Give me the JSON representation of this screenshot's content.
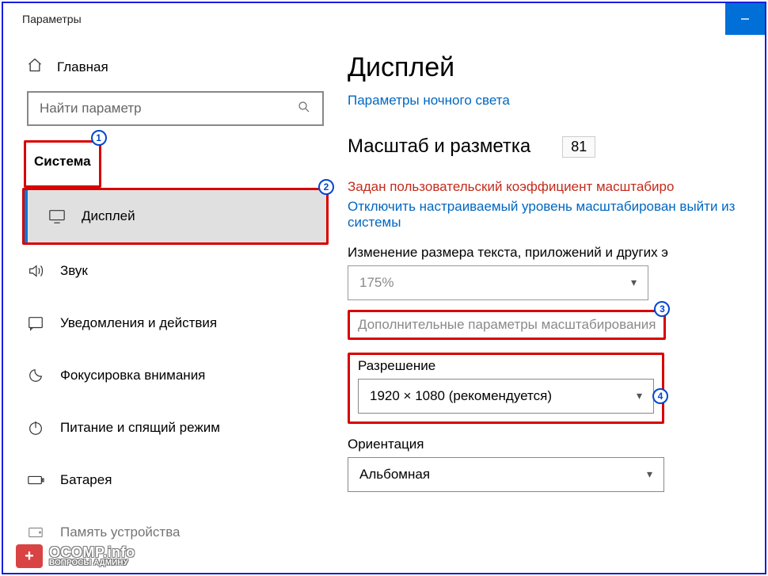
{
  "window": {
    "title": "Параметры"
  },
  "sidebar": {
    "home_label": "Главная",
    "search_placeholder": "Найти параметр",
    "category": "Система",
    "items": [
      {
        "label": "Дисплей",
        "icon": "monitor"
      },
      {
        "label": "Звук",
        "icon": "sound"
      },
      {
        "label": "Уведомления и действия",
        "icon": "notification"
      },
      {
        "label": "Фокусировка внимания",
        "icon": "focus"
      },
      {
        "label": "Питание и спящий режим",
        "icon": "power"
      },
      {
        "label": "Батарея",
        "icon": "battery"
      },
      {
        "label": "Память устройства",
        "icon": "storage"
      }
    ]
  },
  "main": {
    "title": "Дисплей",
    "night_light_link": "Параметры ночного света",
    "scale_heading": "Масштаб и разметка",
    "zoom_value": "81",
    "custom_scale_warning": "Задан пользовательский коэффициент масштабиро",
    "disable_scale_link": "Отключить настраиваемый уровень масштабирован выйти из системы",
    "scale_label": "Изменение размера текста, приложений и других э",
    "scale_value": "175%",
    "advanced_scaling": "Дополнительные параметры масштабирования",
    "resolution_label": "Разрешение",
    "resolution_value": "1920 × 1080 (рекомендуется)",
    "orientation_label": "Ориентация",
    "orientation_value": "Альбомная"
  },
  "annotations": {
    "1": "1",
    "2": "2",
    "3": "3",
    "4": "4"
  },
  "watermark": {
    "site": "OCOMP.info",
    "tagline": "ВОПРОСЫ АДМИНУ"
  }
}
